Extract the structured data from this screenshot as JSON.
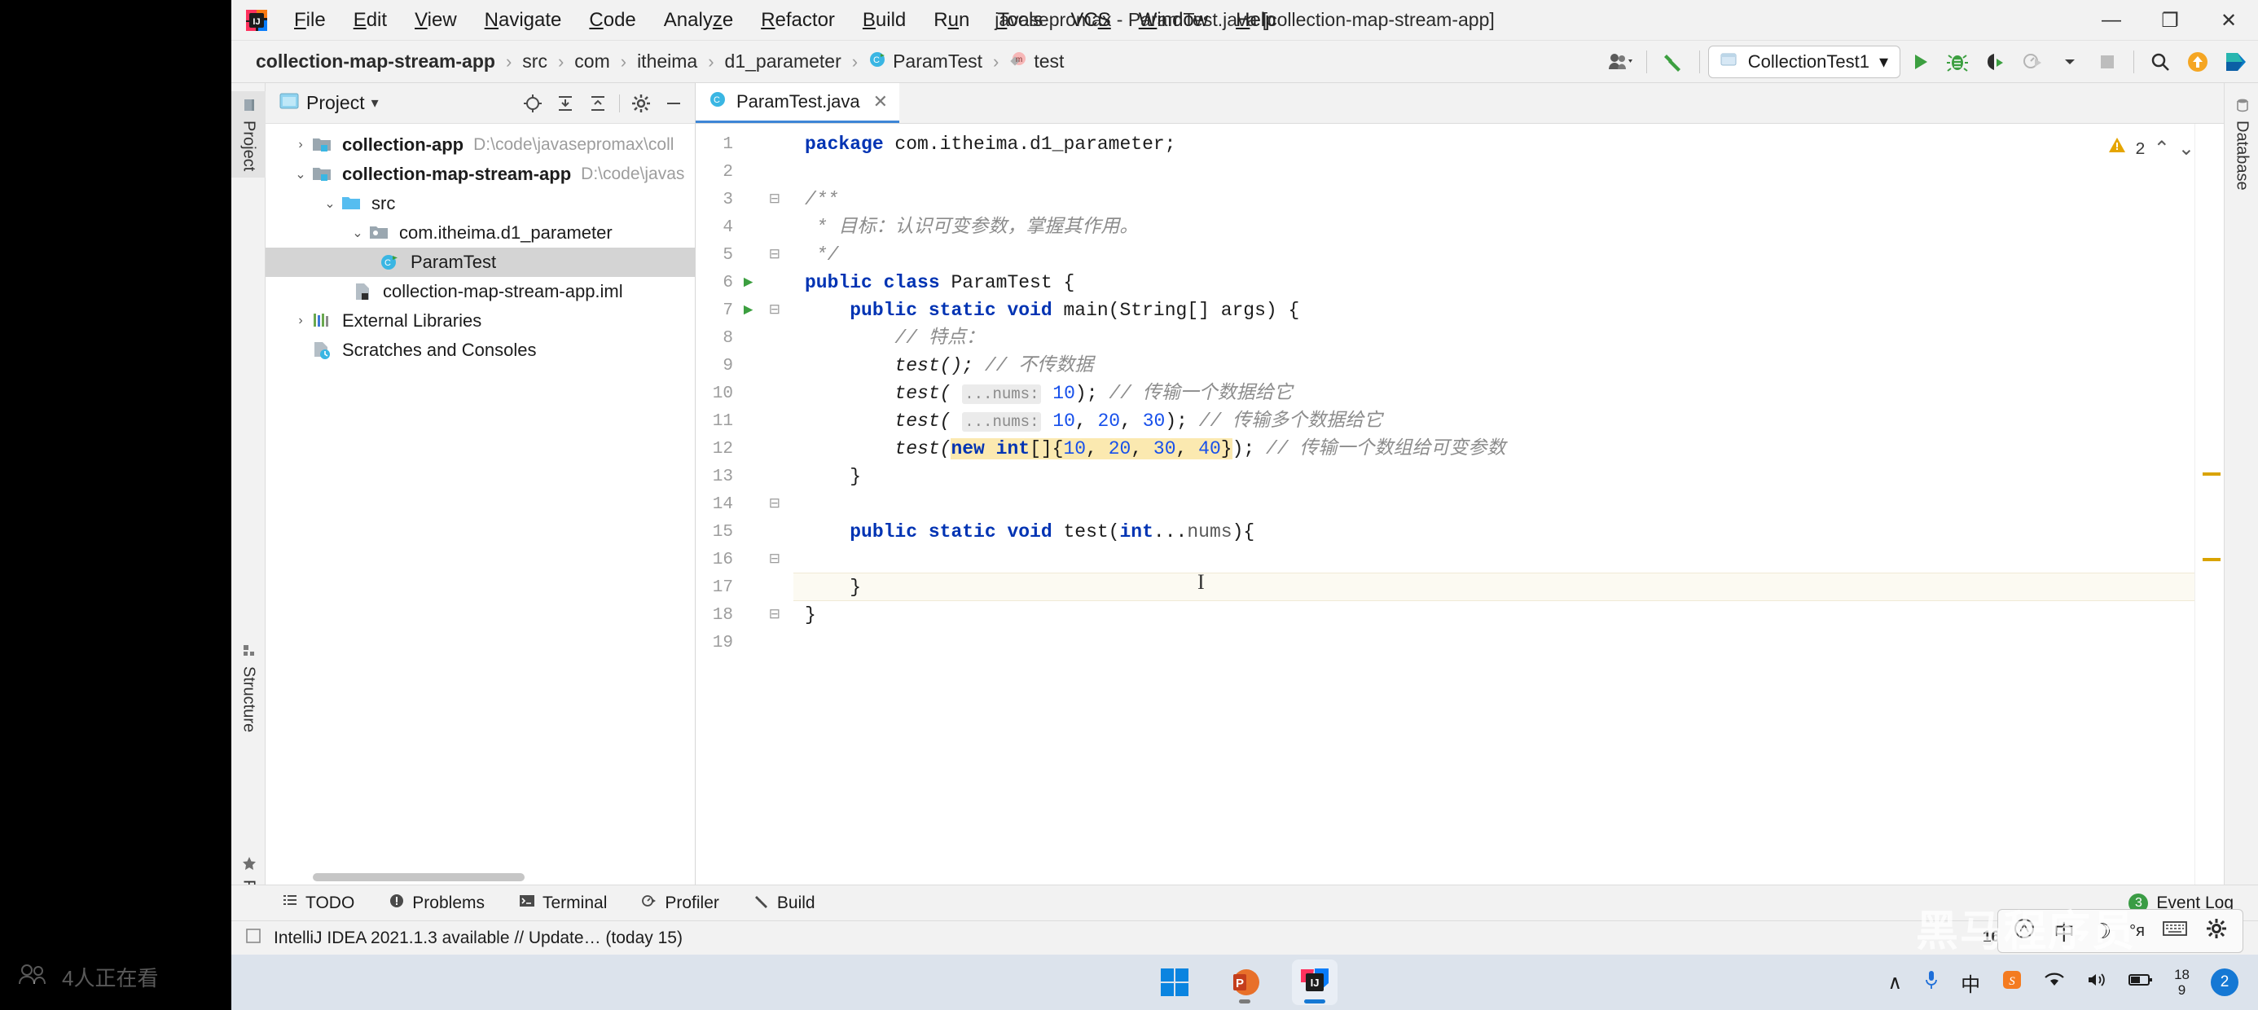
{
  "window": {
    "title": "javasepromax - ParamTest.java [collection-map-stream-app]",
    "minimize": "—",
    "maximize": "❐",
    "close": "✕",
    "logo_icon": "intellij-idea-logo"
  },
  "menu": {
    "items": [
      {
        "label": "File",
        "mnemonic": "F"
      },
      {
        "label": "Edit",
        "mnemonic": "E"
      },
      {
        "label": "View",
        "mnemonic": "V"
      },
      {
        "label": "Navigate",
        "mnemonic": "N"
      },
      {
        "label": "Code",
        "mnemonic": "C"
      },
      {
        "label": "Analyze",
        "mnemonic": "z"
      },
      {
        "label": "Refactor",
        "mnemonic": "R"
      },
      {
        "label": "Build",
        "mnemonic": "B"
      },
      {
        "label": "Run",
        "mnemonic": "u"
      },
      {
        "label": "Tools",
        "mnemonic": "T"
      },
      {
        "label": "VCS",
        "mnemonic": "S"
      },
      {
        "label": "Window",
        "mnemonic": "W"
      },
      {
        "label": "Help",
        "mnemonic": "H"
      }
    ]
  },
  "breadcrumb": {
    "separator": "›",
    "items": [
      {
        "label": "collection-map-stream-app",
        "icon": "",
        "bold": true
      },
      {
        "label": "src",
        "icon": ""
      },
      {
        "label": "com",
        "icon": ""
      },
      {
        "label": "itheima",
        "icon": ""
      },
      {
        "label": "d1_parameter",
        "icon": ""
      },
      {
        "label": "ParamTest",
        "icon": "class-icon"
      },
      {
        "label": "test",
        "icon": "method-icon"
      }
    ]
  },
  "toolbar": {
    "run_config": "CollectionTest1",
    "run_config_icon": "run-config-icon",
    "dropdown_caret": "▾",
    "buttons": [
      {
        "name": "user-accounts-button",
        "icon": "user-icon"
      },
      {
        "name": "build-project-button",
        "icon": "hammer-icon"
      },
      {
        "name": "run-button",
        "icon": "play-icon"
      },
      {
        "name": "debug-button",
        "icon": "bug-icon"
      },
      {
        "name": "run-with-coverage-button",
        "icon": "coverage-icon"
      },
      {
        "name": "profiler-button",
        "icon": "profiler-icon"
      },
      {
        "name": "stop-button",
        "icon": "stop-icon"
      },
      {
        "name": "search-everywhere-button",
        "icon": "search-icon"
      },
      {
        "name": "update-button",
        "icon": "update-arrow-icon"
      },
      {
        "name": "ide-helper-button",
        "icon": "ide-logo-icon"
      }
    ]
  },
  "project_panel": {
    "title": "Project",
    "title_caret": "▾",
    "header_icons": [
      {
        "name": "select-opened-file-icon",
        "glyph": "⊕"
      },
      {
        "name": "expand-all-icon",
        "glyph": "⤓"
      },
      {
        "name": "collapse-all-icon",
        "glyph": "⤒"
      },
      {
        "name": "settings-gear-icon",
        "glyph": "⚙"
      },
      {
        "name": "hide-panel-icon",
        "glyph": "—"
      }
    ],
    "tree": [
      {
        "label": "collection-app",
        "path": "D:\\code\\javasepromax\\coll",
        "indent": 0,
        "arrow": "›",
        "icon": "module-icon",
        "bold": true,
        "selected": false
      },
      {
        "label": "collection-map-stream-app",
        "path": "D:\\code\\javas",
        "indent": 0,
        "arrow": "⌄",
        "icon": "module-icon",
        "bold": true,
        "selected": false
      },
      {
        "label": "src",
        "path": "",
        "indent": 1,
        "arrow": "⌄",
        "icon": "source-folder-icon",
        "bold": false,
        "selected": false
      },
      {
        "label": "com.itheima.d1_parameter",
        "path": "",
        "indent": 2,
        "arrow": "⌄",
        "icon": "package-icon",
        "bold": false,
        "selected": false
      },
      {
        "label": "ParamTest",
        "path": "",
        "indent": 3,
        "arrow": "",
        "icon": "class-icon",
        "bold": false,
        "selected": true
      },
      {
        "label": "collection-map-stream-app.iml",
        "path": "",
        "indent": 2,
        "arrow": "",
        "icon": "iml-file-icon",
        "bold": false,
        "selected": false
      },
      {
        "label": "External Libraries",
        "path": "",
        "indent": 0,
        "arrow": "›",
        "icon": "libraries-icon",
        "bold": false,
        "selected": false
      },
      {
        "label": "Scratches and Consoles",
        "path": "",
        "indent": 0,
        "arrow": "",
        "icon": "scratches-icon",
        "bold": false,
        "selected": false
      }
    ]
  },
  "left_tool_tabs": [
    {
      "label": "Project",
      "icon": "project-icon",
      "selected": true
    },
    {
      "label": "Structure",
      "icon": "structure-icon",
      "selected": false
    },
    {
      "label": "Favorites",
      "icon": "star-icon",
      "selected": false
    }
  ],
  "right_tool_tabs": [
    {
      "label": "Database",
      "icon": "database-icon",
      "selected": false
    }
  ],
  "editor": {
    "tab": {
      "label": "ParamTest.java",
      "icon": "java-file-icon",
      "close": "✕"
    },
    "inspection": {
      "warning_count": "2",
      "warning_icon": "warning-triangle-icon",
      "up": "⌃",
      "down": "⌄"
    },
    "caret_line": 16,
    "lines": [
      {
        "n": 1,
        "runnable": false,
        "fold": "",
        "tokens": [
          {
            "t": "package ",
            "c": "kw"
          },
          {
            "t": "com.itheima.d1_parameter;",
            "c": ""
          }
        ]
      },
      {
        "n": 2,
        "runnable": false,
        "fold": "",
        "tokens": []
      },
      {
        "n": 3,
        "runnable": false,
        "fold": "⊟",
        "tokens": [
          {
            "t": "/**",
            "c": "cm"
          }
        ]
      },
      {
        "n": 4,
        "runnable": false,
        "fold": "",
        "tokens": [
          {
            "t": " * 目标：认识可变参数，掌握其作用。",
            "c": "cm"
          }
        ]
      },
      {
        "n": 5,
        "runnable": false,
        "fold": "⊟",
        "tokens": [
          {
            "t": " */",
            "c": "cm"
          }
        ]
      },
      {
        "n": 6,
        "runnable": true,
        "fold": "",
        "tokens": [
          {
            "t": "public class ",
            "c": "kw"
          },
          {
            "t": "ParamTest {",
            "c": ""
          }
        ]
      },
      {
        "n": 7,
        "runnable": true,
        "fold": "⊟",
        "tokens": [
          {
            "t": "    public static void ",
            "c": "kw"
          },
          {
            "t": "main(",
            "c": ""
          },
          {
            "t": "String",
            "c": ""
          },
          {
            "t": "[] args) {",
            "c": ""
          }
        ]
      },
      {
        "n": 8,
        "runnable": false,
        "fold": "",
        "tokens": [
          {
            "t": "        // 特点：",
            "c": "cm"
          }
        ]
      },
      {
        "n": 9,
        "runnable": false,
        "fold": "",
        "tokens": [
          {
            "t": "        test(); ",
            "c": "it"
          },
          {
            "t": "// 不传数据",
            "c": "cm"
          }
        ]
      },
      {
        "n": 10,
        "runnable": false,
        "fold": "",
        "tokens": [
          {
            "t": "        test( ",
            "c": "it"
          },
          {
            "t": "...nums:",
            "c": "hint"
          },
          {
            "t": " ",
            "c": ""
          },
          {
            "t": "10",
            "c": "num"
          },
          {
            "t": "); ",
            "c": ""
          },
          {
            "t": "// 传输一个数据给它",
            "c": "cm"
          }
        ]
      },
      {
        "n": 11,
        "runnable": false,
        "fold": "",
        "tokens": [
          {
            "t": "        test( ",
            "c": "it"
          },
          {
            "t": "...nums:",
            "c": "hint"
          },
          {
            "t": " ",
            "c": ""
          },
          {
            "t": "10",
            "c": "num"
          },
          {
            "t": ", ",
            "c": ""
          },
          {
            "t": "20",
            "c": "num"
          },
          {
            "t": ", ",
            "c": ""
          },
          {
            "t": "30",
            "c": "num"
          },
          {
            "t": "); ",
            "c": ""
          },
          {
            "t": "// 传输多个数据给它",
            "c": "cm"
          }
        ]
      },
      {
        "n": 12,
        "runnable": false,
        "fold": "",
        "tokens": [
          {
            "t": "        test(",
            "c": "it"
          },
          {
            "t": "new int",
            "c": "kw-sel"
          },
          {
            "t": "[]{",
            "c": "sel"
          },
          {
            "t": "10",
            "c": "num-sel"
          },
          {
            "t": ", ",
            "c": "sel"
          },
          {
            "t": "20",
            "c": "num-sel"
          },
          {
            "t": ", ",
            "c": "sel"
          },
          {
            "t": "30",
            "c": "num-sel"
          },
          {
            "t": ", ",
            "c": "sel"
          },
          {
            "t": "40",
            "c": "num-sel"
          },
          {
            "t": "}",
            "c": "sel"
          },
          {
            "t": "); ",
            "c": ""
          },
          {
            "t": "// 传输一个数组给可变参数",
            "c": "cm"
          }
        ]
      },
      {
        "n": 13,
        "runnable": false,
        "fold": "⊟",
        "tokens": [
          {
            "t": "    }",
            "c": ""
          }
        ]
      },
      {
        "n": 14,
        "runnable": false,
        "fold": "",
        "tokens": []
      },
      {
        "n": 15,
        "runnable": false,
        "fold": "⊟",
        "tokens": [
          {
            "t": "    public static void ",
            "c": "kw"
          },
          {
            "t": "test(",
            "c": ""
          },
          {
            "t": "int",
            "c": "kw"
          },
          {
            "t": "...nums){",
            "c": ""
          }
        ]
      },
      {
        "n": 16,
        "runnable": false,
        "fold": "",
        "tokens": []
      },
      {
        "n": 17,
        "runnable": false,
        "fold": "⊟",
        "tokens": [
          {
            "t": "    }",
            "c": ""
          }
        ]
      },
      {
        "n": 18,
        "runnable": false,
        "fold": "",
        "tokens": [
          {
            "t": "}",
            "c": ""
          }
        ]
      },
      {
        "n": 19,
        "runnable": false,
        "fold": "",
        "tokens": []
      }
    ]
  },
  "bottom_tabs": [
    {
      "label": "TODO",
      "icon": "todo-icon"
    },
    {
      "label": "Problems",
      "icon": "problems-icon"
    },
    {
      "label": "Terminal",
      "icon": "terminal-icon"
    },
    {
      "label": "Profiler",
      "icon": "profiler-icon"
    },
    {
      "label": "Build",
      "icon": "build-hammer-icon"
    }
  ],
  "event_log": {
    "label": "Event Log",
    "count": "3"
  },
  "status_bar": {
    "message": "IntelliJ IDEA 2021.1.3 available // Update… (today 15)",
    "checkbox_icon": "checkbox-icon"
  },
  "overlays": {
    "viewers_text": "4人正在看",
    "viewers_icon": "viewers-icon",
    "watermark": "黑马程序员",
    "aspect_ratio": "16:9"
  },
  "ime_bar": {
    "items": [
      {
        "name": "ime-logo-icon",
        "glyph": "Ⓐ"
      },
      {
        "name": "ime-chinese-icon",
        "glyph": "中"
      },
      {
        "name": "ime-moon-icon",
        "glyph": "☽"
      },
      {
        "name": "ime-punctuation-icon",
        "glyph": "°я"
      },
      {
        "name": "ime-keyboard-icon",
        "glyph": "⌨"
      },
      {
        "name": "ime-settings-icon",
        "glyph": "⚙"
      }
    ]
  },
  "taskbar": {
    "apps": [
      {
        "name": "start-button",
        "icon": "windows-logo-icon",
        "active": false
      },
      {
        "name": "powerpoint-app",
        "icon": "powerpoint-icon",
        "active": false
      },
      {
        "name": "intellij-app",
        "icon": "intellij-icon",
        "active": true
      }
    ],
    "tray": [
      {
        "name": "show-hidden-icons",
        "glyph": "∧"
      },
      {
        "name": "microphone-icon",
        "glyph": "Ἲ4"
      },
      {
        "name": "ime-language-icon",
        "glyph": "中"
      },
      {
        "name": "sogou-input-icon",
        "glyph": "S"
      },
      {
        "name": "wifi-icon",
        "glyph": "◠"
      },
      {
        "name": "volume-icon",
        "glyph": "ὐA"
      },
      {
        "name": "battery-icon",
        "glyph": "ὐB"
      }
    ],
    "clock_line1": "18",
    "clock_line2": "9",
    "notification_count": "2"
  },
  "colors": {
    "accent_blue": "#3e86d6",
    "keyword_blue": "#0033b3",
    "number_blue": "#1750eb",
    "comment_gray": "#8c8c8c",
    "selection_yellow": "#fbe9b0",
    "warning_yellow": "#e5a500",
    "run_green": "#3c9f40",
    "update_orange": "#f5a623"
  }
}
